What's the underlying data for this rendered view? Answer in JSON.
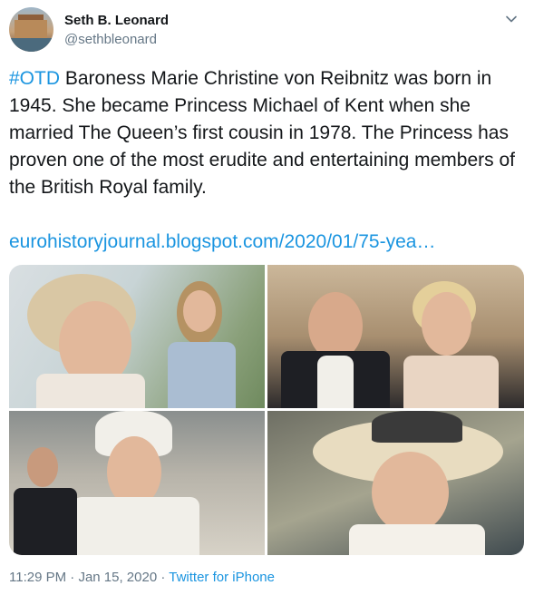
{
  "author": {
    "name": "Seth B. Leonard",
    "handle": "@sethbleonard"
  },
  "tweet": {
    "hashtag": "#OTD",
    "text": " Baroness Marie Christine von Reibnitz was born in 1945. She became Princess Michael of Kent when she married The Queen’s first cousin in 1978. The Princess has proven one of the most erudite and entertaining members of the British Royal family.",
    "link": "eurohistoryjournal.blogspot.com/2020/01/75-yea…"
  },
  "footer": {
    "time": "11:29 PM",
    "separator1": " · ",
    "date": "Jan 15, 2020",
    "separator2": " · ",
    "source": "Twitter for iPhone"
  },
  "icons": {
    "menu": "chevron-down-icon"
  },
  "colors": {
    "accent": "#1b95e0",
    "muted": "#657786",
    "text": "#14171a"
  }
}
